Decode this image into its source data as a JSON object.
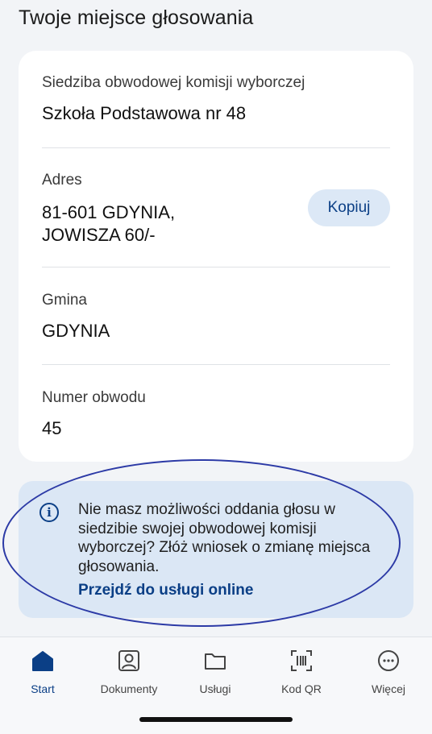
{
  "page": {
    "title": "Twoje miejsce głosowania"
  },
  "card": {
    "seat": {
      "label": "Siedziba obwodowej komisji wyborczej",
      "value": "Szkoła Podstawowa nr 48"
    },
    "address": {
      "label": "Adres",
      "line1": "81-601 GDYNIA,",
      "line2": "JOWISZA 60/-",
      "copy_label": "Kopiuj"
    },
    "municipality": {
      "label": "Gmina",
      "value": "GDYNIA"
    },
    "district": {
      "label": "Numer obwodu",
      "value": "45"
    }
  },
  "info": {
    "icon": "info-icon",
    "text": "Nie masz możliwości oddania głosu w siedzibie swojej obwodowej komisji wyborczej? Złóż wniosek o zmianę miejsca głosowania.",
    "link": "Przejdź do usługi online"
  },
  "nav": {
    "items": [
      {
        "label": "Start",
        "icon": "home-icon",
        "active": true
      },
      {
        "label": "Dokumenty",
        "icon": "person-icon"
      },
      {
        "label": "Usługi",
        "icon": "folder-icon"
      },
      {
        "label": "Kod QR",
        "icon": "qr-scan-icon"
      },
      {
        "label": "Więcej",
        "icon": "more-icon"
      }
    ]
  },
  "colors": {
    "accent": "#0b3f86",
    "info_bg": "#dbe7f5",
    "annotation": "#2c3aa6"
  }
}
